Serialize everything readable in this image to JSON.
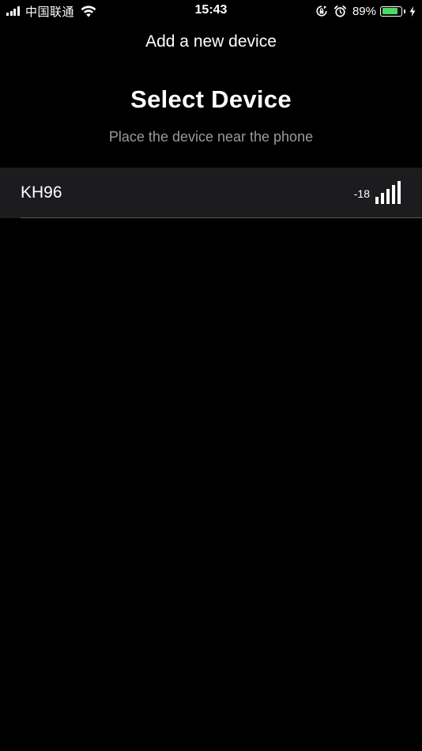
{
  "status_bar": {
    "carrier": "中国联通",
    "time": "15:43",
    "battery_percent": "89%",
    "battery_level": 0.89,
    "battery_color": "#4cd964",
    "icons": [
      "cellular-signal-icon",
      "wifi-icon",
      "rotation-lock-icon",
      "alarm-icon",
      "battery-icon",
      "charging-bolt-icon"
    ]
  },
  "header": {
    "nav_title": "Add a new device",
    "title": "Select Device",
    "subtitle": "Place the device near the phone"
  },
  "devices": [
    {
      "name": "KH96",
      "rssi": "-18",
      "signal_level": 5,
      "signal_max": 5
    }
  ],
  "colors": {
    "background": "#000000",
    "row_background": "#1c1c1e",
    "subtitle_text": "#9a9a9a",
    "divider": "#5a5a5c"
  }
}
